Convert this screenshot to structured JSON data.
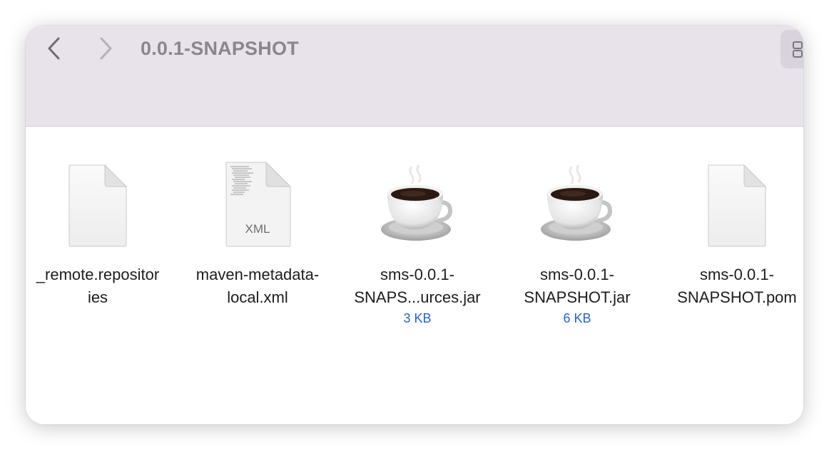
{
  "window": {
    "title": "0.0.1-SNAPSHOT"
  },
  "toolbar": {
    "back_icon": "chevron-left-icon",
    "forward_icon": "chevron-right-icon",
    "view_icon": "grid-view-icon"
  },
  "files": [
    {
      "name": "_remote.repositor\nies",
      "icon": "generic-document-icon",
      "size": ""
    },
    {
      "name": "maven-metadata-\nlocal.xml",
      "icon": "xml-document-icon",
      "icon_label": "XML",
      "size": ""
    },
    {
      "name": "sms-0.0.1-\nSNAPS...urces.jar",
      "icon": "java-coffee-cup-icon",
      "size": "3 KB"
    },
    {
      "name": "sms-0.0.1-\nSNAPSHOT.jar",
      "icon": "java-coffee-cup-icon",
      "size": "6 KB"
    },
    {
      "name": "sms-0.0.1-\nSNAPSHOT.pom",
      "icon": "generic-document-icon",
      "size": ""
    }
  ],
  "colors": {
    "toolbar_bg": "#e8e3ea",
    "title": "#8a868d",
    "size_text": "#2563c8"
  }
}
